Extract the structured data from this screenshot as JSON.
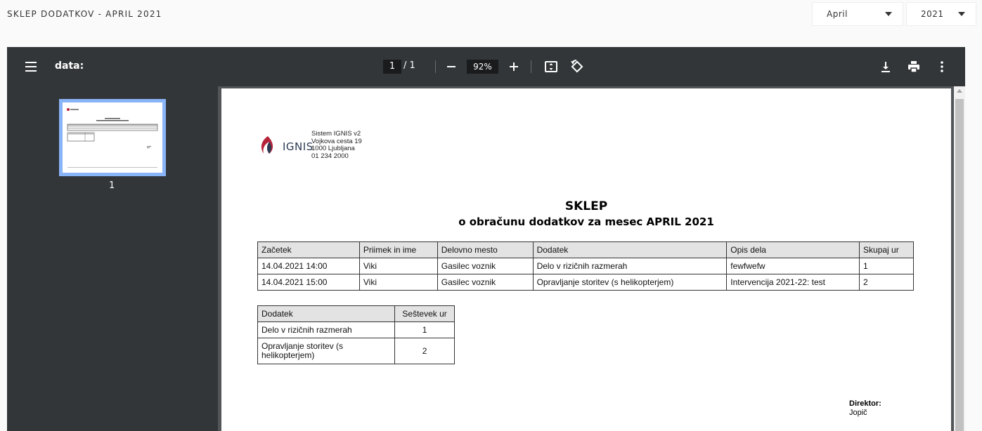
{
  "header": {
    "title": "SKLEP DODATKOV - APRIL 2021",
    "month_select": "April",
    "year_select": "2021"
  },
  "viewer": {
    "doc_title": "data:",
    "current_page": "1",
    "page_separator": "/ 1",
    "zoom": "92%",
    "thumbnail_page": "1",
    "icons": [
      "menu-icon",
      "zoom-out-icon",
      "zoom-in-icon",
      "fit-page-icon",
      "rotate-icon",
      "download-icon",
      "print-icon",
      "more-icon"
    ]
  },
  "document": {
    "logo_text": "IGNIS",
    "address": [
      "Sistem IGNIS v2",
      "Vojkova cesta 19",
      "1000 Ljubljana",
      "01 234 2000"
    ],
    "title": "SKLEP",
    "subtitle": "o obračunu dodatkov za mesec APRIL 2021",
    "main_table": {
      "headers": [
        "Začetek",
        "Priimek in ime",
        "Delovno mesto",
        "Dodatek",
        "Opis dela",
        "Skupaj ur"
      ],
      "rows": [
        [
          "14.04.2021 14:00",
          "Viki",
          "Gasilec voznik",
          "Delo v rizičnih razmerah",
          "fewfwefw",
          "1"
        ],
        [
          "14.04.2021 15:00",
          "Viki",
          "Gasilec voznik",
          "Opravljanje storitev (s helikopterjem)",
          "Intervencija 2021-22: test",
          "2"
        ]
      ]
    },
    "summary_table": {
      "headers": [
        "Dodatek",
        "Seštevek ur"
      ],
      "rows": [
        [
          "Delo v rizičnih razmerah",
          "1"
        ],
        [
          "Opravljanje storitev (s helikopterjem)",
          "2"
        ]
      ]
    },
    "signature": {
      "label": "Direktor:",
      "name": "Jopič"
    }
  },
  "colors": {
    "toolbar": "#323639",
    "viewer_bg": "#525659",
    "thumb_highlight": "#8ab4f8",
    "table_header": "#e3e3e3",
    "logo_red": "#b5233a",
    "logo_navy": "#2d3b55"
  }
}
